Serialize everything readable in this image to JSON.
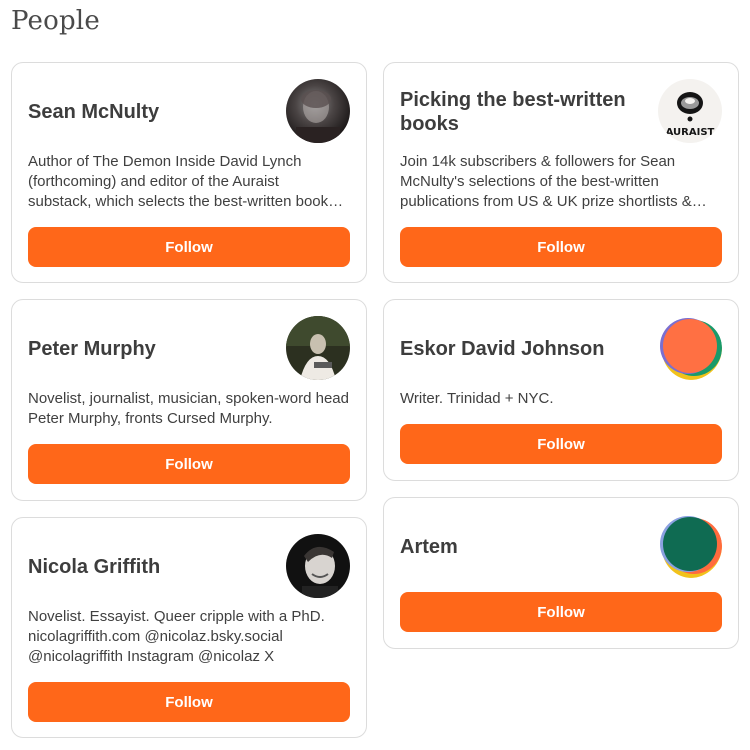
{
  "section": {
    "title": "People"
  },
  "cards": [
    {
      "name": "Sean McNulty",
      "bio_lines": [
        "Author of The Demon Inside David Lynch",
        "(forthcoming) and editor of the Auraist",
        "substack, which selects the best-written book…"
      ],
      "follow_label": "Follow",
      "avatar_icon": "portrait-photo"
    },
    {
      "name": "Peter Murphy",
      "bio_lines": [
        "Novelist, journalist, musician, spoken-word head",
        "Peter Murphy, fronts Cursed Murphy."
      ],
      "follow_label": "Follow",
      "avatar_icon": "portrait-photo"
    },
    {
      "name": "Nicola Griffith",
      "bio_lines": [
        "Novelist. Essayist. Queer cripple with a PhD.",
        "nicolagriffith.com @nicolaz.bsky.social",
        "@nicolagriffith Instagram @nicolaz X"
      ],
      "follow_label": "Follow",
      "avatar_icon": "portrait-photo"
    },
    {
      "name_lines": [
        "Picking the best-written",
        "books"
      ],
      "bio_lines": [
        "Join 14k subscribers & followers for Sean",
        "McNulty's selections of the best-written",
        "publications from US & UK prize shortlists &…"
      ],
      "follow_label": "Follow",
      "avatar_icon": "auraist-logo",
      "avatar_text": "AURAIST"
    },
    {
      "name": "Eskor David Johnson",
      "bio_lines": [
        "Writer. Trinidad + NYC."
      ],
      "follow_label": "Follow",
      "avatar_icon": "default-avatar-orange"
    },
    {
      "name": "Artem",
      "bio_lines": [],
      "follow_label": "Follow",
      "avatar_icon": "default-avatar-green"
    }
  ],
  "colors": {
    "accent": "#ff6719",
    "border": "#dcdcdc",
    "text": "#363737"
  }
}
